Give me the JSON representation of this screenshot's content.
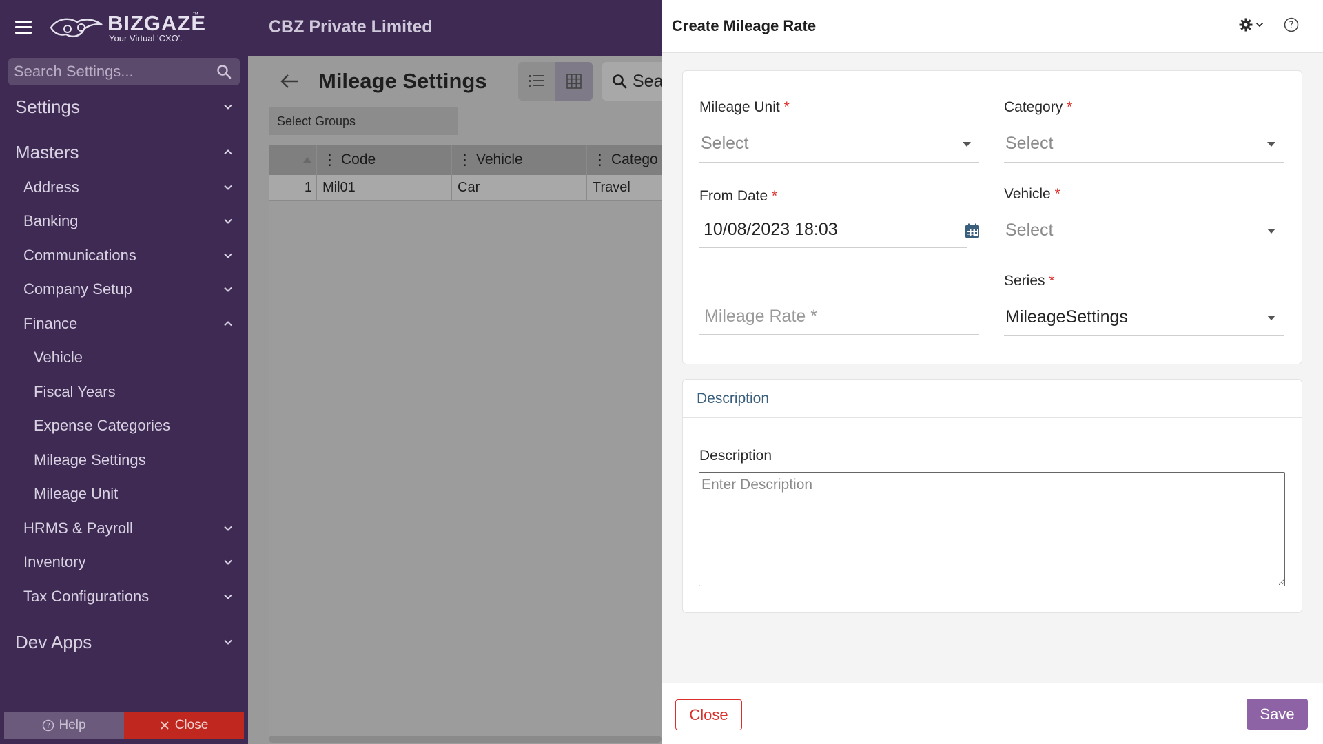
{
  "topbar": {
    "brand": "BIZGAZE",
    "brand_tm": "™",
    "tagline": "Your Virtual 'CXO'.",
    "company": "CBZ Private Limited"
  },
  "sidebar": {
    "search_placeholder": "Search Settings...",
    "items": [
      {
        "label": "Settings",
        "expanded": false
      },
      {
        "label": "Masters",
        "expanded": true
      },
      {
        "label": "Address",
        "expanded": false
      },
      {
        "label": "Banking",
        "expanded": false
      },
      {
        "label": "Communications",
        "expanded": false
      },
      {
        "label": "Company Setup",
        "expanded": false
      },
      {
        "label": "Finance",
        "expanded": true
      },
      {
        "label": "Vehicle"
      },
      {
        "label": "Fiscal Years"
      },
      {
        "label": "Expense Categories"
      },
      {
        "label": "Mileage Settings"
      },
      {
        "label": "Mileage Unit"
      },
      {
        "label": "HRMS & Payroll",
        "expanded": false
      },
      {
        "label": "Inventory",
        "expanded": false
      },
      {
        "label": "Tax Configurations",
        "expanded": false
      },
      {
        "label": "Dev Apps",
        "expanded": false
      }
    ],
    "help_label": "Help",
    "close_label": "Close"
  },
  "main": {
    "title": "Mileage Settings",
    "search_text": "Sea",
    "select_groups": "Select Groups",
    "grid": {
      "columns": [
        "Code",
        "Vehicle",
        "Catego"
      ],
      "rows": [
        {
          "index": "1",
          "code": "Mil01",
          "vehicle": "Car",
          "category": "Travel"
        }
      ]
    }
  },
  "drawer": {
    "title": "Create Mileage Rate",
    "fields": {
      "mileage_unit": {
        "label": "Mileage Unit",
        "value": "Select"
      },
      "category": {
        "label": "Category",
        "value": "Select"
      },
      "from_date": {
        "label": "From Date",
        "value": "10/08/2023 18:03"
      },
      "vehicle": {
        "label": "Vehicle",
        "value": "Select"
      },
      "mileage_rate": {
        "placeholder": "Mileage Rate *"
      },
      "series": {
        "label": "Series",
        "value": "MileageSettings"
      }
    },
    "required_mark": "*",
    "description_section": {
      "header": "Description",
      "label": "Description",
      "placeholder": "Enter Description"
    },
    "footer": {
      "close_label": "Close",
      "save_label": "Save"
    }
  },
  "colors": {
    "topbar": "#3e2a52",
    "sidebar": "#3f2a53",
    "required": "#d9302c",
    "save_button": "#8e63a6",
    "close_button_border": "#d9302c"
  }
}
